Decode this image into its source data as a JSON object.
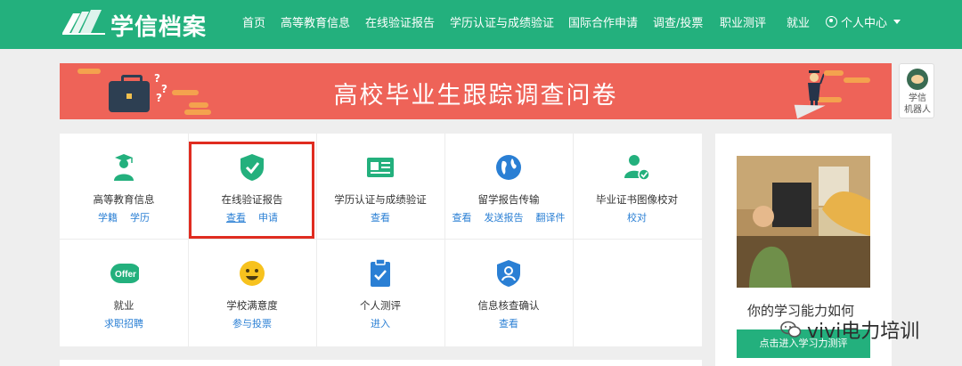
{
  "header": {
    "brand": "学信档案",
    "nav": [
      "首页",
      "高等教育信息",
      "在线验证报告",
      "学历认证与成绩验证",
      "国际合作申请",
      "调查/投票",
      "职业测评",
      "就业"
    ],
    "user_menu": "个人中心"
  },
  "banner": {
    "title": "高校毕业生跟踪调查问卷"
  },
  "robot": {
    "label_line1": "学信",
    "label_line2": "机器人"
  },
  "services": [
    {
      "title": "高等教育信息",
      "links": [
        "学籍",
        "学历"
      ],
      "icon": "graduate-person-icon"
    },
    {
      "title": "在线验证报告",
      "links": [
        "查看",
        "申请"
      ],
      "icon": "verified-shield-icon"
    },
    {
      "title": "学历认证与成绩验证",
      "links": [
        "查看"
      ],
      "icon": "id-card-icon"
    },
    {
      "title": "留学报告传输",
      "links": [
        "查看",
        "发送报告",
        "翻译件"
      ],
      "icon": "globe-icon"
    },
    {
      "title": "毕业证书图像校对",
      "links": [
        "校对"
      ],
      "icon": "user-check-icon"
    },
    {
      "title": "就业",
      "links": [
        "求职招聘"
      ],
      "icon": "offer-badge-icon",
      "badge_text": "Offer"
    },
    {
      "title": "学校满意度",
      "links": [
        "参与投票"
      ],
      "icon": "smiley-icon"
    },
    {
      "title": "个人测评",
      "links": [
        "进入"
      ],
      "icon": "clipboard-check-icon"
    },
    {
      "title": "信息核查确认",
      "links": [
        "查看"
      ],
      "icon": "user-shield-icon"
    }
  ],
  "sidebar_card": {
    "title": "你的学习能力如何",
    "button": "点击进入学习力测评"
  },
  "watermark": {
    "text": "vivi电力培训"
  },
  "colors": {
    "brand_green": "#23b07d",
    "banner_red": "#ee6358",
    "link_blue": "#2a7fd4",
    "highlight_red": "#e02c20"
  }
}
